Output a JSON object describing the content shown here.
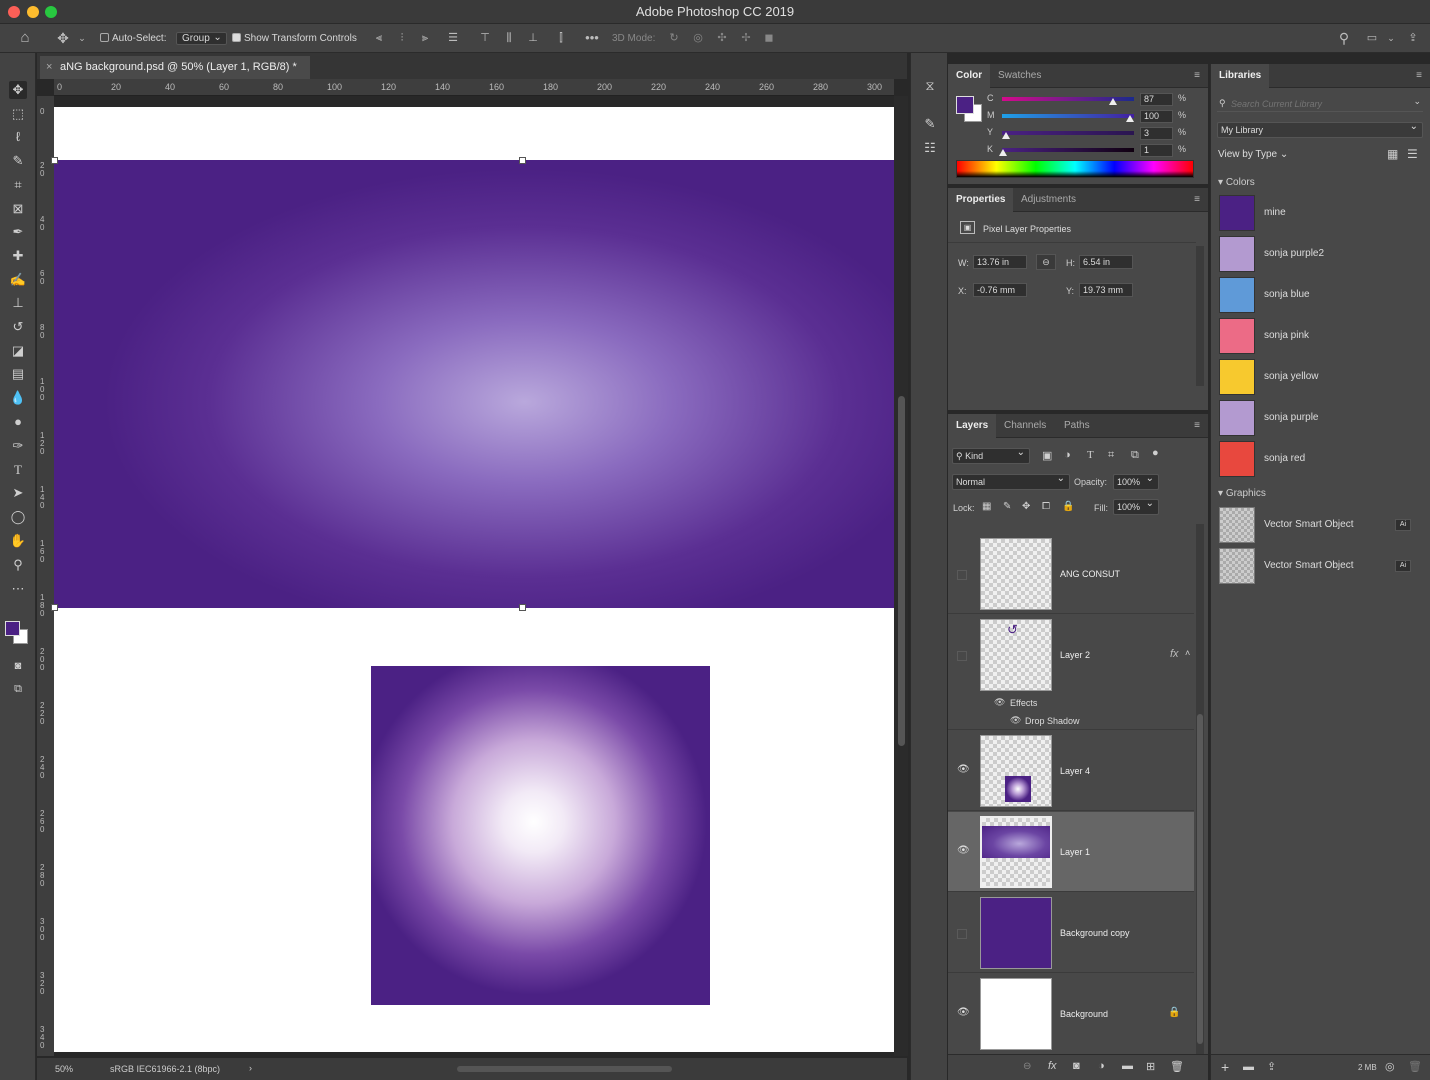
{
  "window": {
    "title": "Adobe Photoshop CC 2019"
  },
  "options_bar": {
    "auto_select_label": "Auto-Select:",
    "auto_select_checked": false,
    "auto_select_target": "Group",
    "show_transform_label": "Show Transform Controls",
    "show_transform_checked": true,
    "mode_3d_label": "3D Mode:"
  },
  "document": {
    "tab_title": "aNG background.psd @ 50% (Layer 1, RGB/8) *",
    "zoom": "50%",
    "color_profile": "sRGB IEC61966-2.1 (8bpc)"
  },
  "rulers": {
    "horizontal": [
      "0",
      "20",
      "40",
      "60",
      "80",
      "100",
      "120",
      "140",
      "160",
      "180",
      "200",
      "220",
      "240",
      "260",
      "280",
      "300"
    ],
    "vertical": [
      "0",
      "2\n0",
      "4\n0",
      "6\n0",
      "8\n0",
      "1\n0\n0",
      "1\n2\n0",
      "1\n4\n0",
      "1\n6\n0",
      "1\n8\n0",
      "2\n0\n0",
      "2\n2\n0",
      "2\n4\n0",
      "2\n6\n0",
      "2\n8\n0",
      "3\n0\n0",
      "3\n2\n0",
      "3\n4\n0"
    ]
  },
  "color_panel": {
    "tabs": [
      "Color",
      "Swatches"
    ],
    "channels": [
      {
        "label": "C",
        "value": "87",
        "unit": "%",
        "fraction": 0.87
      },
      {
        "label": "M",
        "value": "100",
        "unit": "%",
        "fraction": 1.0
      },
      {
        "label": "Y",
        "value": "3",
        "unit": "%",
        "fraction": 0.03
      },
      {
        "label": "K",
        "value": "1",
        "unit": "%",
        "fraction": 0.01
      }
    ],
    "foreground": "#4b2184",
    "background": "#ffffff"
  },
  "properties_panel": {
    "tabs": [
      "Properties",
      "Adjustments"
    ],
    "heading": "Pixel Layer Properties",
    "w_label": "W:",
    "w_value": "13.76 in",
    "h_label": "H:",
    "h_value": "6.54 in",
    "x_label": "X:",
    "x_value": "-0.76 mm",
    "y_label": "Y:",
    "y_value": "19.73 mm"
  },
  "layers_panel": {
    "tabs": [
      "Layers",
      "Channels",
      "Paths"
    ],
    "filter_kind": "Kind",
    "blend_mode": "Normal",
    "opacity_label": "Opacity:",
    "opacity_value": "100%",
    "lock_label": "Lock:",
    "fill_label": "Fill:",
    "fill_value": "100%",
    "layers": [
      {
        "name": "ANG CONSUT",
        "visible": false,
        "selected": false
      },
      {
        "name": "Layer 2",
        "visible": false,
        "selected": false,
        "fx": "fx",
        "effects_label": "Effects",
        "effect": "Drop Shadow"
      },
      {
        "name": "Layer 4",
        "visible": true,
        "selected": false
      },
      {
        "name": "Layer 1",
        "visible": true,
        "selected": true
      },
      {
        "name": "Background copy",
        "visible": false,
        "selected": false
      },
      {
        "name": "Background",
        "visible": true,
        "selected": false,
        "locked": true
      }
    ]
  },
  "libraries_panel": {
    "title": "Libraries",
    "search_placeholder": "Search Current Library",
    "library": "My Library",
    "view_by": "View by Type",
    "colors_heading": "Colors",
    "colors": [
      {
        "name": "mine",
        "hex": "#4b2184"
      },
      {
        "name": "sonja purple2",
        "hex": "#b39ad0"
      },
      {
        "name": "sonja blue",
        "hex": "#5f9ad8"
      },
      {
        "name": "sonja pink",
        "hex": "#ec6b86"
      },
      {
        "name": "sonja yellow",
        "hex": "#f7c92e"
      },
      {
        "name": "sonja purple",
        "hex": "#b39ad0"
      },
      {
        "name": "sonja red",
        "hex": "#e8483e"
      }
    ],
    "graphics_heading": "Graphics",
    "graphics": [
      {
        "name": "Vector Smart Object",
        "badge": "Ai"
      },
      {
        "name": "Vector Smart Object",
        "badge": "Ai"
      }
    ],
    "storage": "2 MB"
  }
}
